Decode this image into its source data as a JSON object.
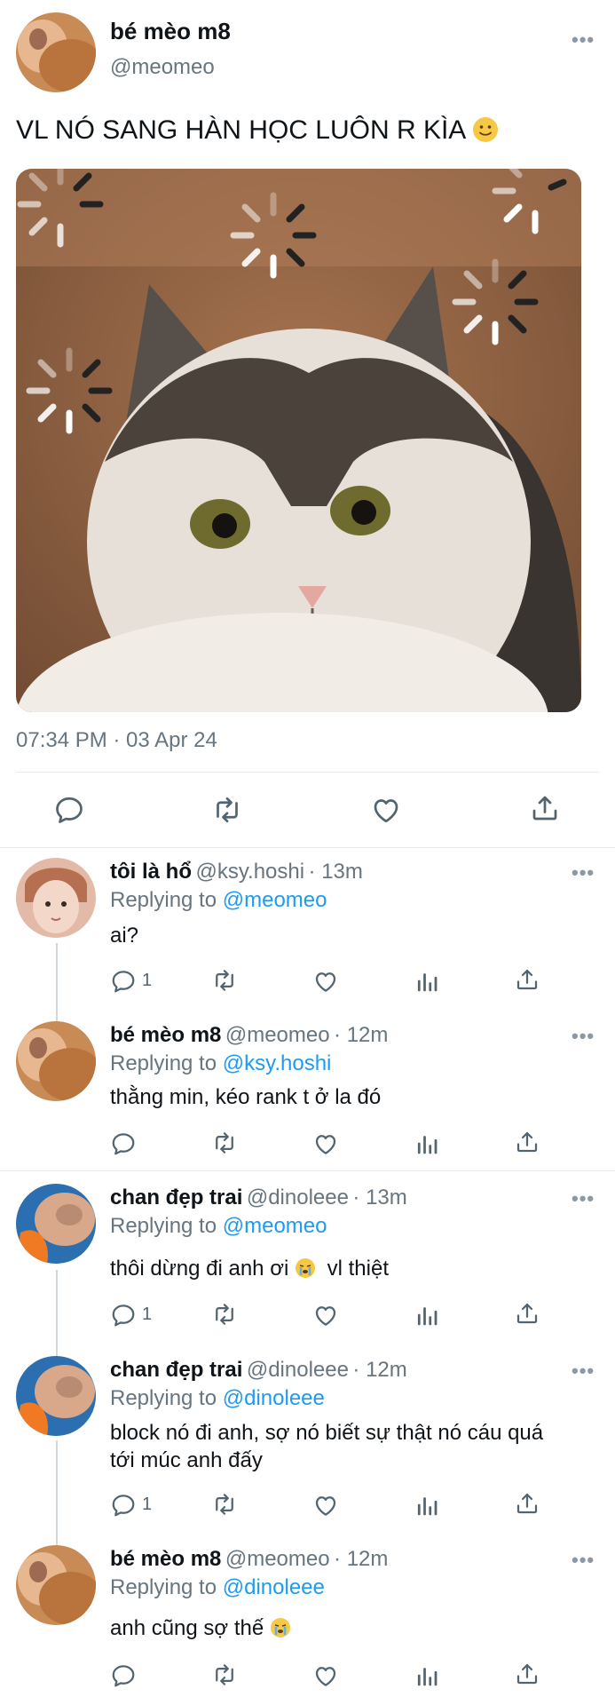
{
  "main_tweet": {
    "display_name": "bé mèo m8",
    "handle": "@meomeo",
    "text": "VL NÓ SANG HÀN HỌC LUÔN R KÌA",
    "timestamp": "07:34 PM · 03 Apr 24",
    "more_label": "•••"
  },
  "replies": [
    {
      "display_name": "tôi là hổ",
      "handle": "@ksy.hoshi",
      "time": "· 13m",
      "replying_prefix": "Replying to",
      "replying_to": "@meomeo",
      "text": "ai?",
      "reply_count": "1"
    },
    {
      "display_name": "bé mèo m8",
      "handle": "@meomeo",
      "time": "· 12m",
      "replying_prefix": "Replying to",
      "replying_to": "@ksy.hoshi",
      "text": "thằng min, kéo rank t ở la đó",
      "reply_count": ""
    },
    {
      "display_name": "chan đẹp trai",
      "handle": "@dinoleee",
      "time": "· 13m",
      "replying_prefix": "Replying to",
      "replying_to": "@meomeo",
      "text": "thôi dừng đi anh ơi",
      "text_after": "vl thiệt",
      "reply_count": "1"
    },
    {
      "display_name": "chan đẹp trai",
      "handle": "@dinoleee",
      "time": "· 12m",
      "replying_prefix": "Replying to",
      "replying_to": "@dinoleee",
      "text_line1": "block nó đi anh, sợ nó biết sự thật nó cáu quá",
      "text_line2": "tới múc anh đấy",
      "reply_count": "1"
    },
    {
      "display_name": "bé mèo m8",
      "handle": "@meomeo",
      "time": "· 12m",
      "replying_prefix": "Replying to",
      "replying_to": "@dinoleee",
      "text": "anh cũng sợ thế",
      "reply_count": ""
    }
  ],
  "icons": [
    "reply-icon",
    "retweet-icon",
    "like-icon",
    "share-icon",
    "analytics-icon",
    "more-icon",
    "smile-emoji",
    "crying-emoji"
  ],
  "colors": {
    "link": "#1d9bf0",
    "text": "#0f1419",
    "muted": "#66757f",
    "divider": "#e6ecf0"
  }
}
